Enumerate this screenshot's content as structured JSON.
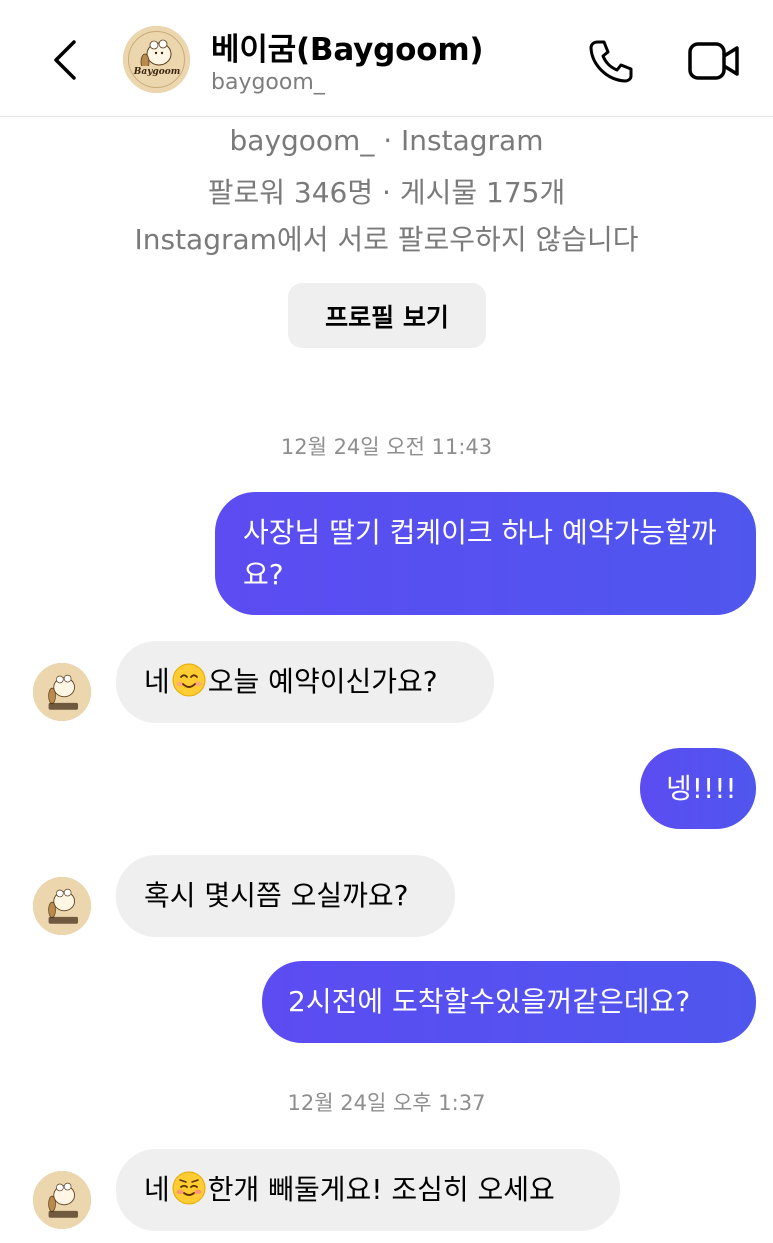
{
  "header": {
    "name": "베이굼(Baygoom)",
    "username": "baygoom_",
    "avatar_label": "Baygoom",
    "back_icon": "chevron-left-icon",
    "call_icon": "phone-icon",
    "video_icon": "video-camera-icon"
  },
  "profile_info": {
    "line1": "baygoom_ · Instagram",
    "line2": "팔로워 346명 · 게시물 175개",
    "line3": "Instagram에서 서로 팔로우하지 않습니다",
    "view_profile_label": "프로필 보기"
  },
  "timestamps": [
    "12월 24일 오전 11:43",
    "12월 24일 오후 1:37"
  ],
  "messages": [
    {
      "sender": "me",
      "text": "사장님 딸기 컵케이크 하나 예약가능할까요?"
    },
    {
      "sender": "them",
      "prefix": "네",
      "emoji": "smiling-face-icon",
      "text": "오늘 예약이신가요?"
    },
    {
      "sender": "me",
      "text": "넹!!!!"
    },
    {
      "sender": "them",
      "text": "혹시 몇시쯤 오실까요?"
    },
    {
      "sender": "me",
      "text": "2시전에 도착할수있을꺼같은데요?"
    },
    {
      "sender": "them",
      "prefix": "네",
      "emoji": "relieved-face-icon",
      "text": "한개 빼둘게요! 조심히 오세요"
    }
  ],
  "colors": {
    "sent_bubble": "#5850f0",
    "received_bubble": "#efefef",
    "secondary_text": "#7a7a7a"
  }
}
